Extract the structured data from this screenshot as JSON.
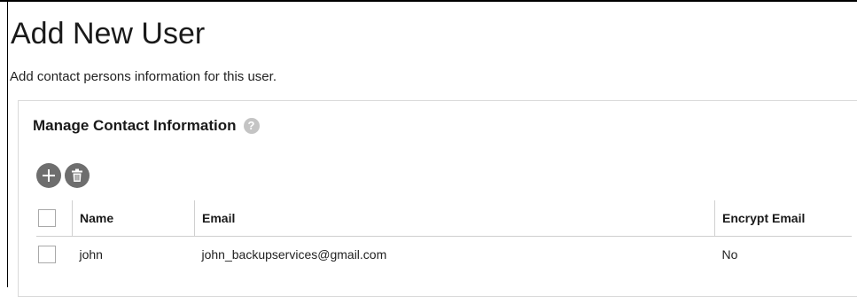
{
  "page": {
    "title": "Add New User",
    "subtitle": "Add contact persons information for this user."
  },
  "panel": {
    "title": "Manage Contact Information",
    "help_icon": "question-circle-icon"
  },
  "toolbar": {
    "add_icon": "plus-icon",
    "delete_icon": "trash-icon"
  },
  "table": {
    "columns": [
      "Name",
      "Email",
      "Encrypt Email"
    ],
    "rows": [
      {
        "checked": false,
        "name": "john",
        "email": "john_backupservices@gmail.com",
        "encrypt_email": "No"
      }
    ]
  },
  "colors": {
    "icon_button": "#6e6e6e",
    "help_icon": "#c4c4c4",
    "border": "#d9d9d9"
  }
}
